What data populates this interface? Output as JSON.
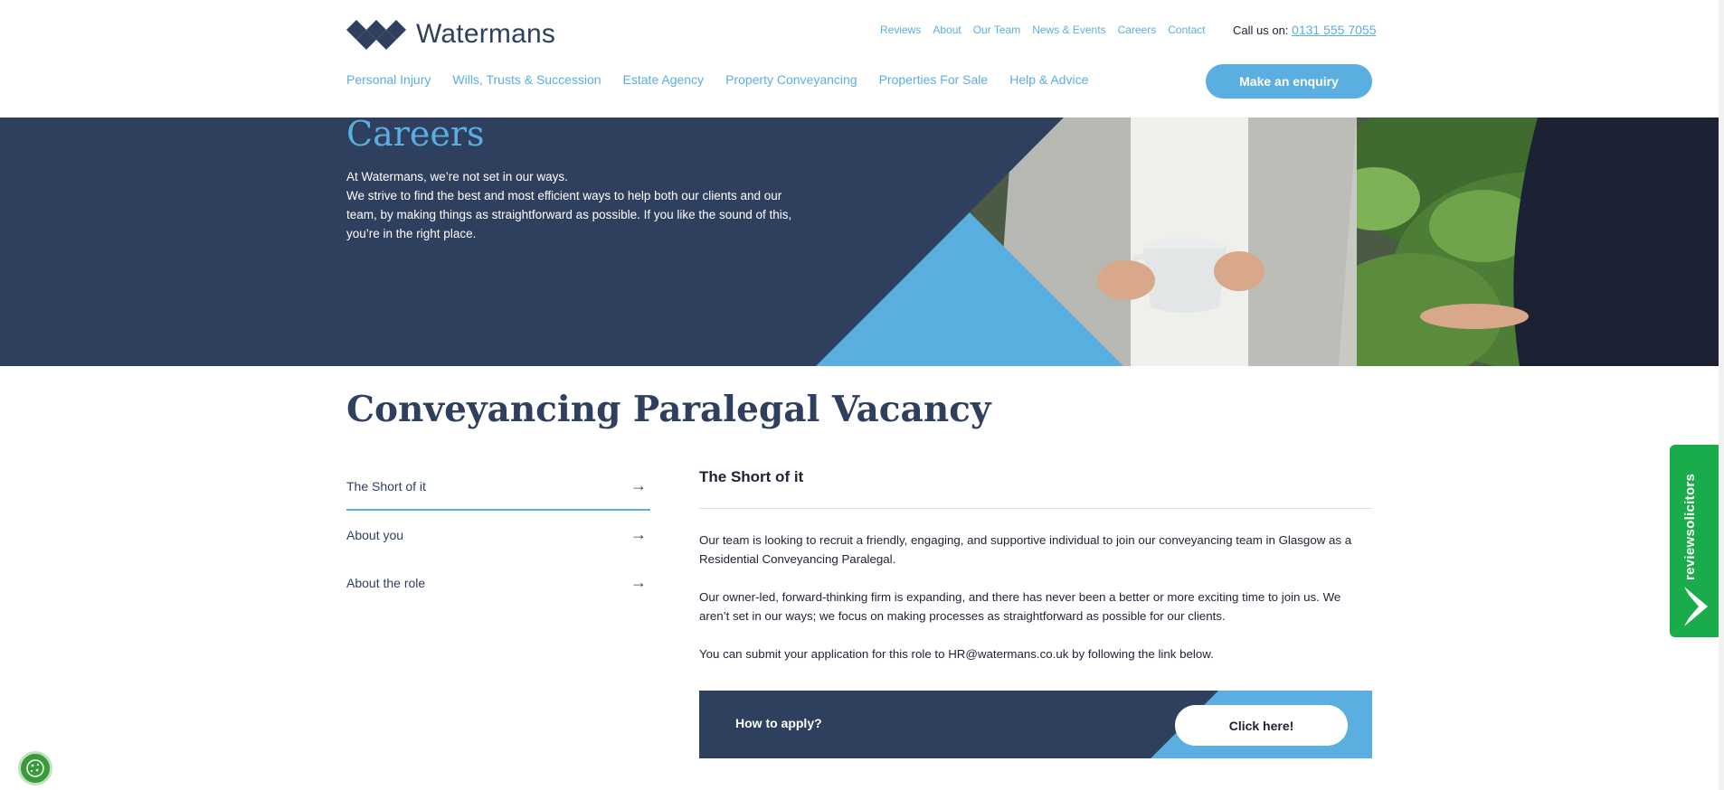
{
  "brand": {
    "name": "Watermans",
    "primary": "#2f3f5e",
    "accent": "#5aaee0",
    "review_green": "#1aab4b"
  },
  "top_nav": [
    "Reviews",
    "About",
    "Our Team",
    "News & Events",
    "Careers",
    "Contact"
  ],
  "callus": {
    "label": "Call us on:",
    "phone": "0131 555 7055"
  },
  "main_nav": [
    "Personal Injury",
    "Wills, Trusts & Succession",
    "Estate Agency",
    "Property Conveyancing",
    "Properties For Sale",
    "Help & Advice"
  ],
  "enquiry_button": "Make an enquiry",
  "hero": {
    "title": "Careers",
    "line1": "At Watermans, we’re not set in our ways.",
    "line2": "We strive to find the best and most efficient ways to help both our clients and our team, by making things as straightforward as possible. If you like the sound of this, you’re in the right place."
  },
  "page_title": "Conveyancing Paralegal Vacancy",
  "side_menu": [
    {
      "label": "The Short of it",
      "active": true,
      "icon": "arrow-right-icon"
    },
    {
      "label": "About you",
      "active": false,
      "icon": "arrow-right-icon"
    },
    {
      "label": "About the role",
      "active": false,
      "icon": "arrow-right-icon"
    }
  ],
  "panel": {
    "heading": "The Short of it",
    "paragraphs": [
      "Our team is looking to recruit a friendly, engaging, and supportive individual to join our conveyancing team in Glasgow as a Residential Conveyancing Paralegal.",
      "Our owner-led, forward-thinking firm is expanding, and there has never been a better or more exciting time to join us. We aren’t set in our ways; we focus on making processes as straightforward as possible for our clients.",
      "You can submit your application for this role to HR@watermans.co.uk by following the link below."
    ]
  },
  "apply": {
    "label": "How to apply?",
    "button": "Click here!"
  },
  "review_badge": "reviewsolicitors",
  "icons": {
    "arrow": "→",
    "cookie": "cookie-icon"
  }
}
